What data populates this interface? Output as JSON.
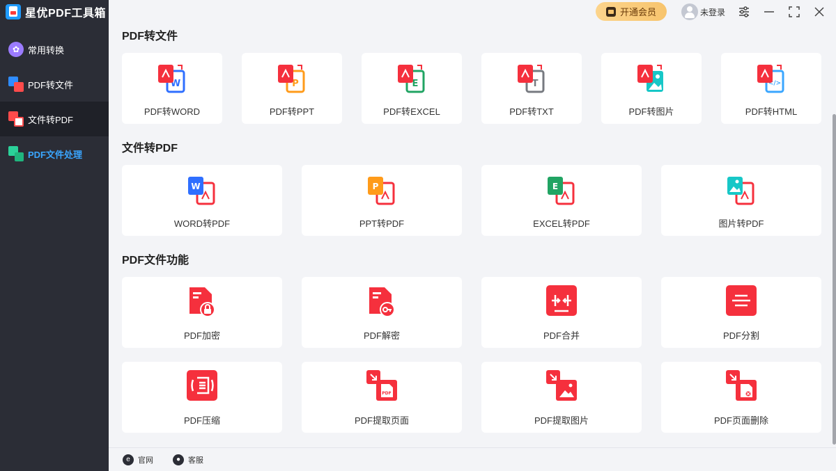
{
  "app": {
    "title": "星优PDF工具箱"
  },
  "sidebar": {
    "items": [
      {
        "label": "常用转换"
      },
      {
        "label": "PDF转文件"
      },
      {
        "label": "文件转PDF"
      },
      {
        "label": "PDF文件处理"
      }
    ]
  },
  "topbar": {
    "vip_label": "开通会员",
    "login_label": "未登录"
  },
  "sections": [
    {
      "title": "PDF转文件",
      "items": [
        {
          "label": "PDF转WORD",
          "color": "#2f6fff",
          "letter": "W"
        },
        {
          "label": "PDF转PPT",
          "color": "#ff9b1a",
          "letter": "P"
        },
        {
          "label": "PDF转EXCEL",
          "color": "#21a463",
          "letter": "E"
        },
        {
          "label": "PDF转TXT",
          "color": "#777a80",
          "letter": "T"
        },
        {
          "label": "PDF转图片",
          "color": "#17c7c7",
          "letter": ""
        },
        {
          "label": "PDF转HTML",
          "color": "#3aa6ff",
          "letter": "</>"
        }
      ]
    },
    {
      "title": "文件转PDF",
      "items": [
        {
          "label": "WORD转PDF",
          "color": "#2f6fff",
          "letter": "W"
        },
        {
          "label": "PPT转PDF",
          "color": "#ff9b1a",
          "letter": "P"
        },
        {
          "label": "EXCEL转PDF",
          "color": "#21a463",
          "letter": "E"
        },
        {
          "label": "图片转PDF",
          "color": "#17c7c7",
          "letter": ""
        }
      ]
    },
    {
      "title": "PDF文件功能",
      "items": [
        {
          "label": "PDF加密"
        },
        {
          "label": "PDF解密"
        },
        {
          "label": "PDF合并"
        },
        {
          "label": "PDF分割"
        },
        {
          "label": "PDF压缩"
        },
        {
          "label": "PDF提取页面"
        },
        {
          "label": "PDF提取图片"
        },
        {
          "label": "PDF页面删除"
        }
      ]
    }
  ],
  "footer": {
    "website_label": "官网",
    "service_label": "客服"
  },
  "colors": {
    "accent": "#3aa6ff",
    "pdf_red": "#f5303d",
    "sidebar_bg": "#2b2d36"
  }
}
